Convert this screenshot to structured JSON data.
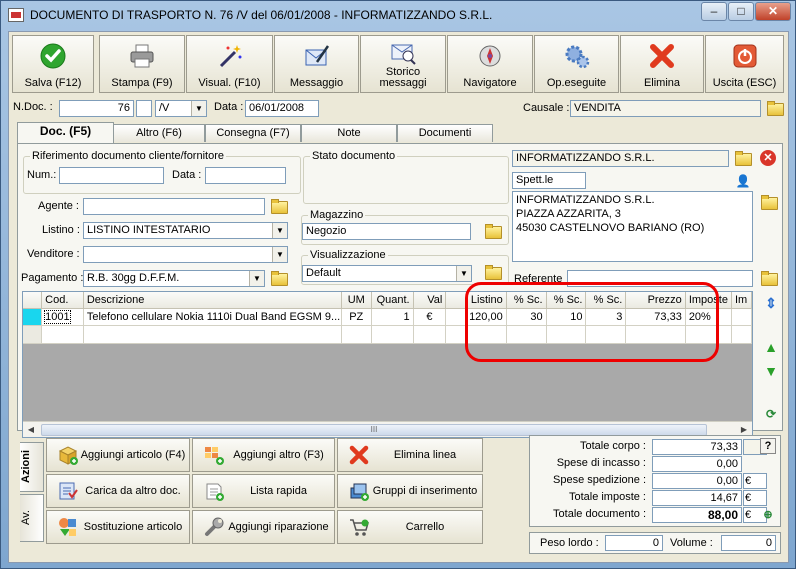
{
  "window": {
    "title": "DOCUMENTO DI TRASPORTO N. 76 /V del 06/01/2008 - INFORMATIZZANDO S.R.L.",
    "minimize": "–",
    "maximize": "□",
    "close": "✕"
  },
  "toolbar": [
    {
      "label": "Salva (F12)",
      "icon": "check-icon",
      "color": "#2fa52f"
    },
    {
      "label": "Stampa (F9)",
      "icon": "printer-icon",
      "color": "#666666"
    },
    {
      "label": "Visual. (F10)",
      "icon": "magic-wand-icon",
      "color": "#333366"
    },
    {
      "label": "Messaggio",
      "icon": "message-icon",
      "color": "#3a62b0"
    },
    {
      "label": "Storico messaggi",
      "icon": "message-history-icon",
      "color": "#4a6ab0"
    },
    {
      "label": "Navigatore",
      "icon": "compass-icon",
      "color": "#7a4aa0"
    },
    {
      "label": "Op.eseguite",
      "icon": "gears-icon",
      "color": "#4a7ac0"
    },
    {
      "label": "Elimina",
      "icon": "delete-x-icon",
      "color": "#e03a1e"
    },
    {
      "label": "Uscita (ESC)",
      "icon": "exit-icon",
      "color": "#d94a2a"
    }
  ],
  "header": {
    "ndoc_label": "N.Doc. :",
    "ndoc_value": "76",
    "series_value": "/V",
    "data_label": "Data :",
    "data_value": "06/01/2008",
    "causale_label": "Causale :",
    "causale_value": "VENDITA"
  },
  "tabs": [
    "Doc. (F5)",
    "Altro (F6)",
    "Consegna (F7)",
    "Note",
    "Documenti"
  ],
  "doc": {
    "rif_title": "Riferimento documento cliente/fornitore",
    "num_label": "Num.:",
    "num_value": "",
    "data_label": "Data :",
    "data_value": "",
    "stato_title": "Stato documento",
    "agente_label": "Agente :",
    "agente_value": "",
    "listino_label": "Listino :",
    "listino_value": "LISTINO INTESTATARIO",
    "venditore_label": "Venditore :",
    "venditore_value": "",
    "pagamento_label": "Pagamento :",
    "pagamento_value": "R.B. 30gg D.F.F.M.",
    "magazzino_title": "Magazzino",
    "magazzino_value": "Negozio",
    "visual_title": "Visualizzazione",
    "visual_value": "Default",
    "cliente_name": "INFORMATIZZANDO S.R.L.",
    "spett": "Spett.le",
    "address": [
      "INFORMATIZZANDO S.R.L.",
      "PIAZZA AZZARITA, 3",
      "45030 CASTELNOVO BARIANO (RO)"
    ],
    "referente_label": "Referente",
    "referente_value": ""
  },
  "grid": {
    "columns": [
      "",
      "Cod.",
      "Descrizione",
      "UM",
      "Quant.",
      "Val",
      "Listino",
      "% Sc.",
      "% Sc.",
      "% Sc.",
      "Prezzo",
      "Imposte",
      "Im"
    ],
    "rows": [
      [
        "",
        "1001",
        "Telefono cellulare Nokia 1110i Dual Band EGSM 9...",
        "PZ",
        "1",
        "€",
        "120,00",
        "30",
        "10",
        "3",
        "73,33",
        "20%",
        ""
      ]
    ],
    "scroll_thumb": "III"
  },
  "actions": {
    "tab_azioni": "Azioni",
    "tab_av": "Av.",
    "buttons": [
      {
        "label": "Aggiungi articolo (F4)",
        "icon": "add-box-icon"
      },
      {
        "label": "Aggiungi altro (F3)",
        "icon": "add-grid-icon"
      },
      {
        "label": "Elimina linea",
        "icon": "delete-x-icon"
      },
      {
        "label": "Carica da altro doc.",
        "icon": "load-doc-icon"
      },
      {
        "label": "Lista rapida",
        "icon": "quick-list-icon"
      },
      {
        "label": "Gruppi di inserimento",
        "icon": "group-insert-icon"
      },
      {
        "label": "Sostituzione articolo",
        "icon": "replace-shapes-icon"
      },
      {
        "label": "Aggiungi riparazione",
        "icon": "wrench-icon"
      },
      {
        "label": "Carrello",
        "icon": "cart-icon"
      }
    ]
  },
  "totals": {
    "totale_corpo_label": "Totale corpo :",
    "totale_corpo": "73,33",
    "help": "?",
    "spese_incasso_label": "Spese di incasso :",
    "spese_incasso": "0,00",
    "spese_spedizione_label": "Spese spedizione :",
    "spese_spedizione": "0,00",
    "spese_spedizione_cur": "€",
    "totale_imposte_label": "Totale imposte :",
    "totale_imposte": "14,67",
    "totale_imposte_cur": "€",
    "totale_documento_label": "Totale documento :",
    "totale_documento": "88,00",
    "totale_documento_cur": "€",
    "peso_label": "Peso lordo :",
    "peso_value": "0",
    "volume_label": "Volume :",
    "volume_value": "0"
  }
}
